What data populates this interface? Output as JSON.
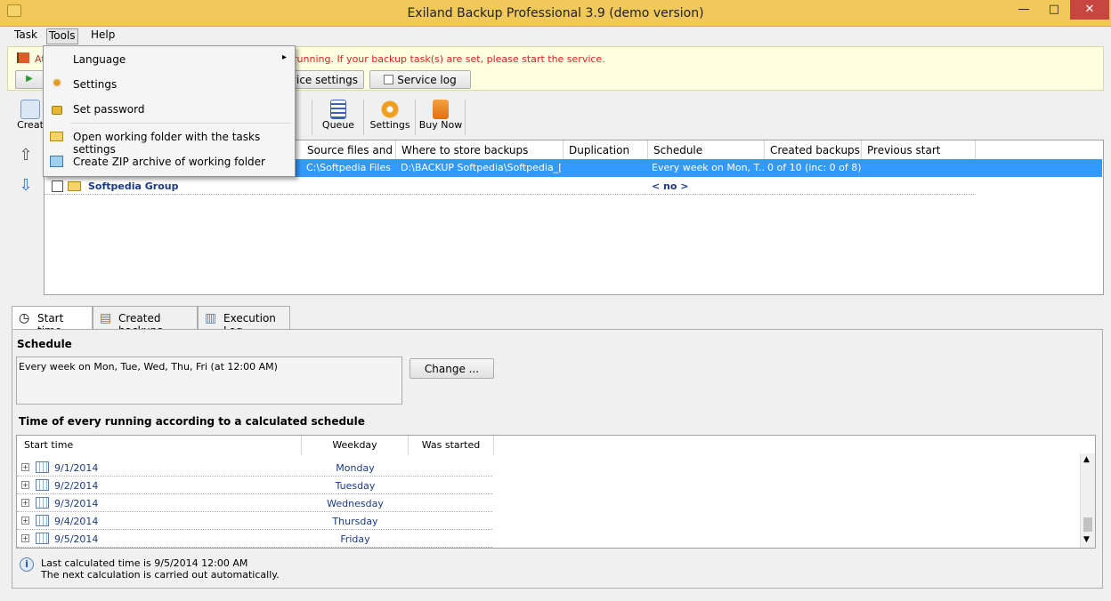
{
  "window": {
    "title": "Exiland Backup Professional 3.9 (demo version)",
    "minimize": "—",
    "maximize": "□",
    "close": "✕"
  },
  "menu": {
    "task": "Task",
    "tools": "Tools",
    "help": "Help"
  },
  "warning": {
    "prefix": "At",
    "text": "running. If your backup task(s) are set, please start the service.",
    "service_settings_btn": "rvice settings",
    "service_log_btn": "Service log"
  },
  "toolbar": {
    "create_label": "Creat",
    "queue_label": "Queue",
    "settings_label": "Settings",
    "buy_now_label": "Buy Now"
  },
  "tools_menu": {
    "items": [
      {
        "label": "Language",
        "icon": "language-icon",
        "submenu": "▸"
      },
      {
        "label": "Settings",
        "icon": "gear-icon"
      },
      {
        "label": "Set password",
        "icon": "lock-icon"
      },
      {
        "label": "Open working folder with the tasks settings",
        "icon": "folder-open-icon"
      },
      {
        "label": "Create ZIP archive of working folder",
        "icon": "zip-archive-icon"
      }
    ]
  },
  "task_grid": {
    "columns": [
      "Source files and ...",
      "Where to store backups",
      "Duplication",
      "Schedule",
      "Created backups",
      "Previous start"
    ],
    "selected_row": {
      "source": "C:\\Softpedia Files",
      "destination": "D:\\BACKUP Softpedia\\Softpedia_[...",
      "duplication": "",
      "schedule": "Every week on Mon, T...",
      "created_backups": "0 of 10 (inc: 0 of 8)",
      "previous_start": ""
    },
    "group_row": {
      "name": "Softpedia Group",
      "schedule": "< no >"
    }
  },
  "tabs": [
    {
      "label": "Start time",
      "icon": "clock-icon"
    },
    {
      "label": "Created backups",
      "icon": "backups-icon"
    },
    {
      "label": "Execution Log",
      "icon": "log-book-icon"
    }
  ],
  "schedule": {
    "heading": "Schedule",
    "text": "Every week on Mon, Tue, Wed, Thu, Fri (at 12:00 AM)",
    "change_btn": "Change ..."
  },
  "calculated": {
    "heading": "Time of every running according to a calculated schedule",
    "columns": [
      "Start time",
      "Weekday",
      "Was started"
    ],
    "rows": [
      {
        "date": "9/1/2014",
        "weekday": "Monday",
        "started": ""
      },
      {
        "date": "9/2/2014",
        "weekday": "Tuesday",
        "started": ""
      },
      {
        "date": "9/3/2014",
        "weekday": "Wednesday",
        "started": ""
      },
      {
        "date": "9/4/2014",
        "weekday": "Thursday",
        "started": ""
      },
      {
        "date": "9/5/2014",
        "weekday": "Friday",
        "started": ""
      }
    ]
  },
  "footer": {
    "line1": "Last calculated time is 9/5/2014  12:00 AM",
    "line2": "The next calculation is carried out automatically."
  },
  "colors": {
    "titlebar": "#f0c95a",
    "selection": "#3399ff",
    "warning_text": "#e02020",
    "link_blue": "#1a3a8a"
  }
}
